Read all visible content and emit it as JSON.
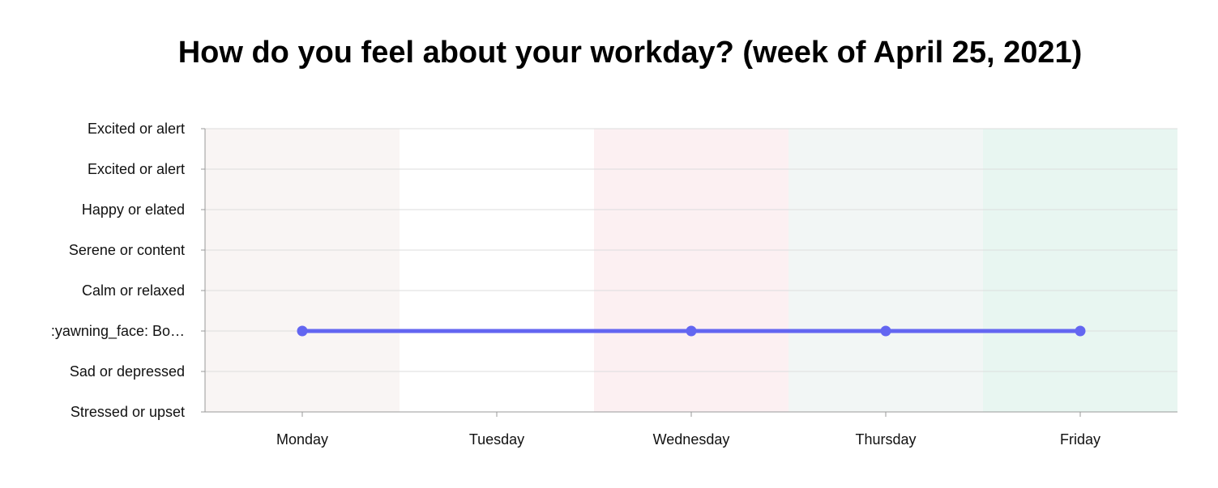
{
  "chart_data": {
    "type": "line",
    "title": "How do you feel about your workday? (week of April 25, 2021)",
    "xlabel": "",
    "ylabel": "",
    "categories": [
      "Monday",
      "Tuesday",
      "Wednesday",
      "Thursday",
      "Friday"
    ],
    "y_categories": [
      "Stressed or upset",
      "Sad or depressed",
      ":yawning_face: Bo…",
      "Calm or relaxed",
      "Serene or content",
      "Happy or elated",
      "Excited or alert",
      "Excited or alert"
    ],
    "series": [
      {
        "points": [
          {
            "x": "Monday",
            "y": ":yawning_face: Bo…"
          },
          {
            "x": "Wednesday",
            "y": ":yawning_face: Bo…"
          },
          {
            "x": "Thursday",
            "y": ":yawning_face: Bo…"
          },
          {
            "x": "Friday",
            "y": ":yawning_face: Bo…"
          }
        ],
        "color": "#6366f1"
      }
    ],
    "band_colors": [
      "#f9f5f4",
      "#ffffff",
      "#fcf0f2",
      "#f2f6f5",
      "#e8f6f1"
    ],
    "grid": true,
    "legend": "none"
  }
}
